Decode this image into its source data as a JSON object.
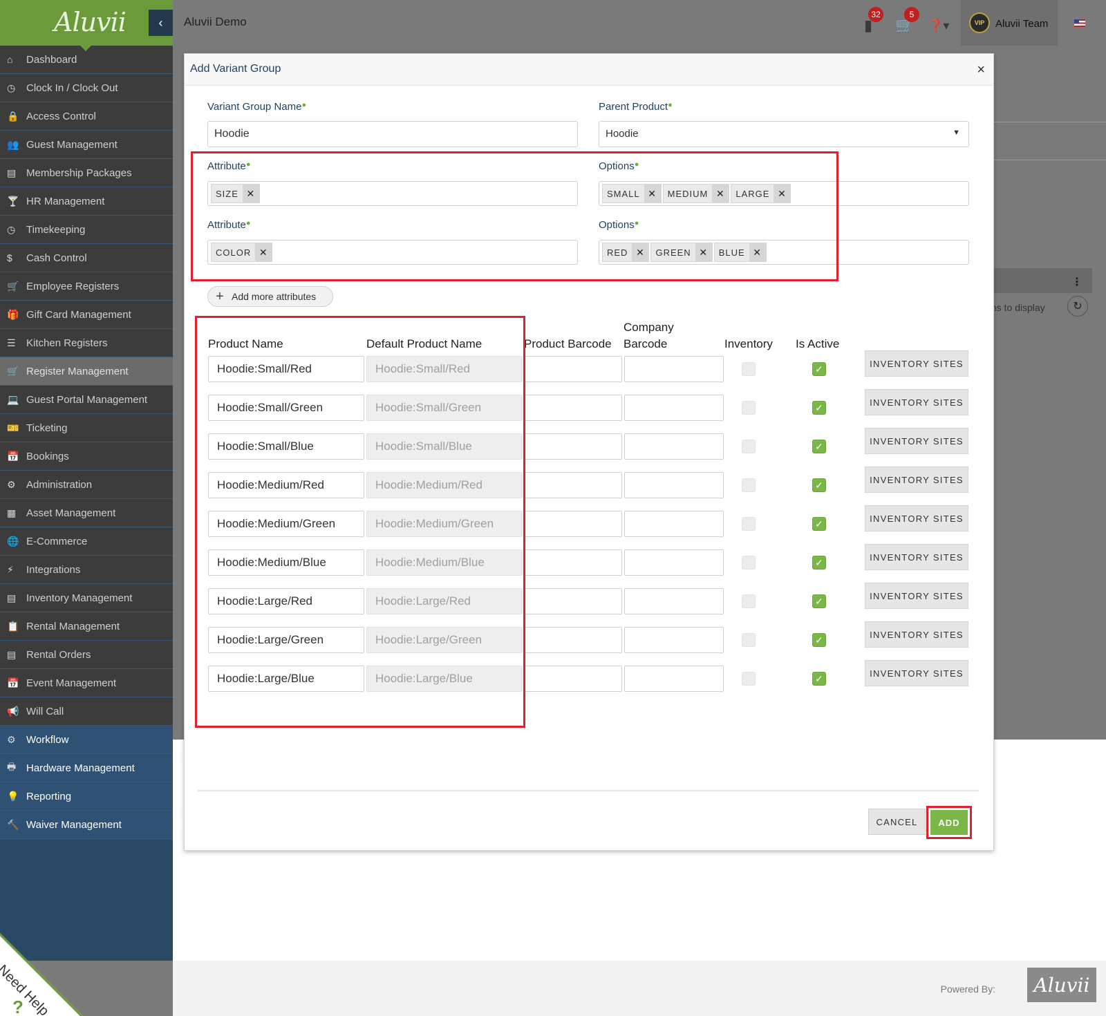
{
  "app": {
    "logo": "Aluvii",
    "title": "Aluvii Demo",
    "user": "Aluvii Team",
    "avatar_text": "VIP"
  },
  "topbar": {
    "notifications_count": "32",
    "cart_count": "5",
    "icons": [
      "notification-bag-icon",
      "cart-icon",
      "help-icon",
      "flag-icon"
    ]
  },
  "sidebar": {
    "items": [
      {
        "label": "Dashboard",
        "icon": "home-icon",
        "glyph": "⌂"
      },
      {
        "label": "Clock In / Clock Out",
        "icon": "clock-icon",
        "glyph": "◷"
      },
      {
        "label": "Access Control",
        "icon": "lock-icon",
        "glyph": "🔒"
      },
      {
        "label": "Guest Management",
        "icon": "users-icon",
        "glyph": "👥"
      },
      {
        "label": "Membership Packages",
        "icon": "list-icon",
        "glyph": "▤"
      },
      {
        "label": "HR Management",
        "icon": "glass-icon",
        "glyph": "🍸"
      },
      {
        "label": "Timekeeping",
        "icon": "clock-icon",
        "glyph": "◷"
      },
      {
        "label": "Cash Control",
        "icon": "dollar-icon",
        "glyph": "$"
      },
      {
        "label": "Employee Registers",
        "icon": "cart-icon",
        "glyph": "🛒"
      },
      {
        "label": "Gift Card Management",
        "icon": "gift-icon",
        "glyph": "🎁"
      },
      {
        "label": "Kitchen Registers",
        "icon": "list-icon",
        "glyph": "☰"
      },
      {
        "label": "Register Management",
        "icon": "cart-icon",
        "glyph": "🛒"
      },
      {
        "label": "Guest Portal Management",
        "icon": "laptop-icon",
        "glyph": "💻"
      },
      {
        "label": "Ticketing",
        "icon": "ticket-icon",
        "glyph": "🎫"
      },
      {
        "label": "Bookings",
        "icon": "calendar-icon",
        "glyph": "📅"
      },
      {
        "label": "Administration",
        "icon": "cogs-icon",
        "glyph": "⚙"
      },
      {
        "label": "Asset Management",
        "icon": "cubes-icon",
        "glyph": "▦"
      },
      {
        "label": "E-Commerce",
        "icon": "globe-icon",
        "glyph": "🌐"
      },
      {
        "label": "Integrations",
        "icon": "bolt-icon",
        "glyph": "⚡"
      },
      {
        "label": "Inventory Management",
        "icon": "archive-icon",
        "glyph": "▤"
      },
      {
        "label": "Rental Management",
        "icon": "clipboard-icon",
        "glyph": "📋"
      },
      {
        "label": "Rental Orders",
        "icon": "book-icon",
        "glyph": "▤"
      },
      {
        "label": "Event Management",
        "icon": "calendar-icon",
        "glyph": "📅"
      },
      {
        "label": "Will Call",
        "icon": "megaphone-icon",
        "glyph": "📢"
      },
      {
        "label": "Workflow",
        "icon": "gear-icon",
        "glyph": "⚙"
      },
      {
        "label": "Hardware Management",
        "icon": "printer-icon",
        "glyph": "🖶"
      },
      {
        "label": "Reporting",
        "icon": "lightbulb-icon",
        "glyph": "💡"
      },
      {
        "label": "Waiver Management",
        "icon": "gavel-icon",
        "glyph": "🔨"
      }
    ]
  },
  "background": {
    "no_items_text": "ms to display"
  },
  "modal": {
    "title": "Add Variant Group",
    "variant_group_name_label": "Variant Group Name",
    "variant_group_name_value": "Hoodie",
    "parent_product_label": "Parent Product",
    "parent_product_value": "Hoodie",
    "attribute_label": "Attribute",
    "options_label": "Options",
    "attributes": [
      {
        "name": "SIZE",
        "options": [
          "SMALL",
          "MEDIUM",
          "LARGE"
        ]
      },
      {
        "name": "COLOR",
        "options": [
          "RED",
          "GREEN",
          "BLUE"
        ]
      }
    ],
    "add_more_attributes": "Add more attributes",
    "table": {
      "headers": {
        "product_name": "Product Name",
        "default_product_name": "Default Product Name",
        "product_barcode": "Product Barcode",
        "company": "Company",
        "barcode": "Barcode",
        "inventory": "Inventory",
        "is_active": "Is Active"
      },
      "rows": [
        {
          "product_name": "Hoodie:Small/Red",
          "default_name": "Hoodie:Small/Red",
          "inventory": false,
          "active": true
        },
        {
          "product_name": "Hoodie:Small/Green",
          "default_name": "Hoodie:Small/Green",
          "inventory": false,
          "active": true
        },
        {
          "product_name": "Hoodie:Small/Blue",
          "default_name": "Hoodie:Small/Blue",
          "inventory": false,
          "active": true
        },
        {
          "product_name": "Hoodie:Medium/Red",
          "default_name": "Hoodie:Medium/Red",
          "inventory": false,
          "active": true
        },
        {
          "product_name": "Hoodie:Medium/Green",
          "default_name": "Hoodie:Medium/Green",
          "inventory": false,
          "active": true
        },
        {
          "product_name": "Hoodie:Medium/Blue",
          "default_name": "Hoodie:Medium/Blue",
          "inventory": false,
          "active": true
        },
        {
          "product_name": "Hoodie:Large/Red",
          "default_name": "Hoodie:Large/Red",
          "inventory": false,
          "active": true
        },
        {
          "product_name": "Hoodie:Large/Green",
          "default_name": "Hoodie:Large/Green",
          "inventory": false,
          "active": true
        },
        {
          "product_name": "Hoodie:Large/Blue",
          "default_name": "Hoodie:Large/Blue",
          "inventory": false,
          "active": true
        }
      ],
      "inventory_sites_label": "INVENTORY SITES"
    },
    "cancel_label": "CANCEL",
    "add_label": "ADD"
  },
  "footer": {
    "powered_by": "Powered By:",
    "logo": "Aluvii",
    "need_help": "Need Help",
    "need_help_icon": "?"
  },
  "colors": {
    "accent_green": "#7ab648",
    "sidebar_blue": "#2b4a66",
    "highlight_red": "#e0202a",
    "badge_red": "#c0201e"
  }
}
